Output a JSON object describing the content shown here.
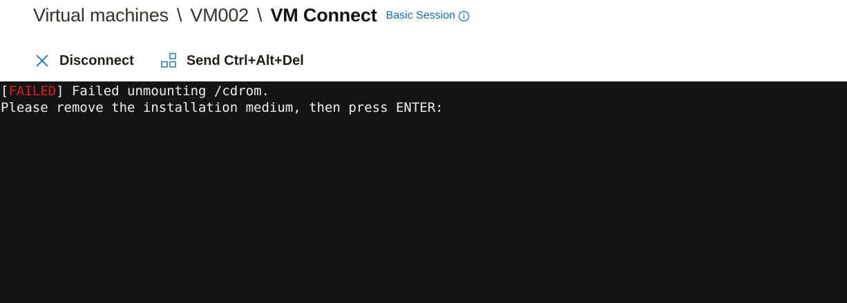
{
  "breadcrumb": {
    "items": [
      "Virtual machines",
      "VM002"
    ],
    "separator": "\\",
    "current": "VM Connect"
  },
  "session": {
    "label": "Basic Session",
    "icon": "info-icon"
  },
  "toolbar": {
    "disconnect_label": "Disconnect",
    "disconnect_icon": "close-icon",
    "ctrl_alt_del_label": "Send Ctrl+Alt+Del",
    "ctrl_alt_del_icon": "keyboard-keys-icon"
  },
  "terminal": {
    "line1_bracket_open": "[",
    "line1_status": "FAILED",
    "line1_bracket_close": "]",
    "line1_message": " Failed unmounting /cdrom.",
    "line2": "Please remove the installation medium, then press ENTER:"
  },
  "colors": {
    "accent": "#0f6cbd",
    "terminal_bg": "#141414",
    "terminal_text": "#f0f0f0",
    "failed": "#e02020"
  }
}
